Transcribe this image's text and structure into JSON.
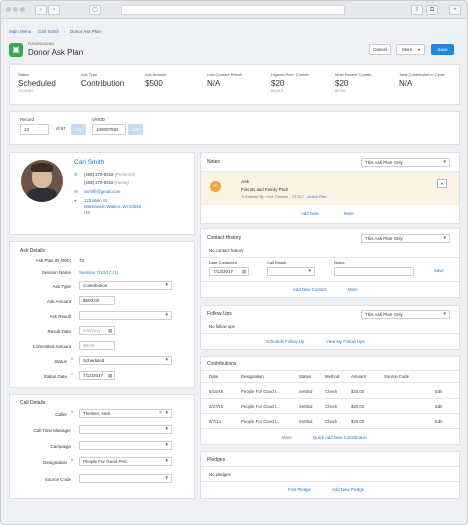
{
  "breadcrumbs": [
    "Main Menu",
    "Carl Smith",
    "Donor Ask Plan"
  ],
  "header": {
    "section": "FUNDRAISING",
    "title": "Donor Ask Plan",
    "cancel": "Cancel",
    "more": "More",
    "save": "Save"
  },
  "stats": [
    {
      "label": "Status",
      "value": "Scheduled",
      "sub": "7/12/2017"
    },
    {
      "label": "Ask Type",
      "value": "Contribution",
      "sub": ""
    },
    {
      "label": "Ask Amount",
      "value": "$500",
      "sub": ""
    },
    {
      "label": "Last Contact Result",
      "value": "N/A",
      "sub": ""
    },
    {
      "label": "Highest Prev. Contrib.",
      "value": "$20",
      "sub": "6/10/15"
    },
    {
      "label": "Most Recent Contrib.",
      "value": "$20",
      "sub": "8/7/14"
    },
    {
      "label": "Total Contributed in Cycle",
      "value": "N/A",
      "sub": ""
    }
  ],
  "record": {
    "label": "Record",
    "value": "13",
    "of": "of 67",
    "go": "Go",
    "vanid_label": "VANID",
    "vanid": "100007932"
  },
  "contact": {
    "name": "Carl Smith",
    "phone1": "(408) 270-8218",
    "phone1_tag": "(Preferred)",
    "phone2": "(408) 270-8218",
    "phone2_tag": "(Home)",
    "email": "csmith@gmail.com",
    "addr1": "123 Main St",
    "addr2": "Manitowish Waters, WI 54545",
    "addr3": "US"
  },
  "ask_details": {
    "title": "Ask Details",
    "plan_id_label": "Ask Plan ID (900)",
    "plan_id": "73",
    "session_label": "Session Name",
    "session": "Session 7/13/17 (1)",
    "ask_type_label": "Ask Type",
    "ask_type": "Contribution",
    "ask_amount_label": "Ask Amount",
    "ask_amount": "$500.00",
    "ask_result_label": "Ask Result",
    "ask_result": "",
    "result_date_label": "Result Date",
    "result_date_ph": "m/d/yyyy",
    "committed_label": "Committed Amount",
    "committed_ph": "$0.00",
    "status_label": "Status",
    "status": "Scheduled",
    "status_date_label": "Status Date",
    "status_date": "7/12/2017"
  },
  "call_details": {
    "title": "Call Details",
    "caller_label": "Caller",
    "caller": "Theisen, Nick",
    "manager_label": "Call Time Manager",
    "campaign_label": "Campaign",
    "designation_label": "Designation",
    "designation": "People For Good PAC",
    "source_label": "Source Code"
  },
  "notes": {
    "title": "Notes",
    "filter": "This Ask Plan Only",
    "badge": "NT",
    "item_title": "Ask",
    "item_sub": "Friends and Family Pitch",
    "item_meta": "Entered By:  Nick Theisen - 7/13/17 - ",
    "item_link": "Action Plan",
    "add": "Add Note",
    "more": "More"
  },
  "contact_history": {
    "title": "Contact History",
    "filter": "This Ask Plan Only",
    "empty": "No contact history",
    "date_label": "Date Contacted",
    "date": "7/13/2017",
    "result_label": "Call Result",
    "notes_label": "Notes",
    "save": "Save",
    "add": "Add New Contact",
    "more": "More"
  },
  "follow_ups": {
    "title": "Follow Ups",
    "filter": "This Ask Plan Only",
    "empty": "No follow ups",
    "schedule": "Schedule Follow Up",
    "view": "View My Follow Ups"
  },
  "contributions": {
    "title": "Contributions",
    "headers": [
      "Date",
      "Designation",
      "Status",
      "Method",
      "Amount",
      "Source Code",
      ""
    ],
    "rows": [
      [
        "6/10/15",
        "People For Good I...",
        "Settled",
        "Check",
        "$20.00",
        "",
        "Edit"
      ],
      [
        "3/27/15",
        "People For Good I...",
        "Settled",
        "Check",
        "$20.00",
        "",
        "Edit"
      ],
      [
        "8/7/14",
        "People For Good I...",
        "Settled",
        "Check",
        "$20.00",
        "",
        "Edit"
      ]
    ],
    "more": "More",
    "quick_add": "Quick Add New Contribution"
  },
  "pledges": {
    "title": "Pledges",
    "empty": "No pledges",
    "find": "Find Pledge",
    "add": "Add New Pledge"
  }
}
